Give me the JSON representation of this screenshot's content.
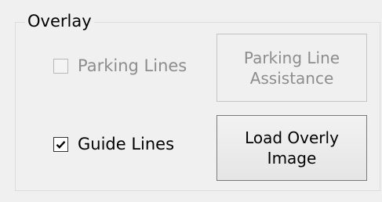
{
  "overlay_group": {
    "title": "Overlay",
    "parking_lines": {
      "label": "Parking Lines",
      "checked": false,
      "enabled": false
    },
    "parking_line_assistance": {
      "label": "Parking Line\nAssistance",
      "enabled": false
    },
    "guide_lines": {
      "label": "Guide Lines",
      "checked": true,
      "enabled": true
    },
    "load_overlay_image": {
      "label": "Load Overly\nImage",
      "enabled": true
    }
  },
  "colors": {
    "window_bg": "#f0f0f0",
    "disabled_text": "#8d8d8d",
    "enabled_text": "#000000"
  }
}
